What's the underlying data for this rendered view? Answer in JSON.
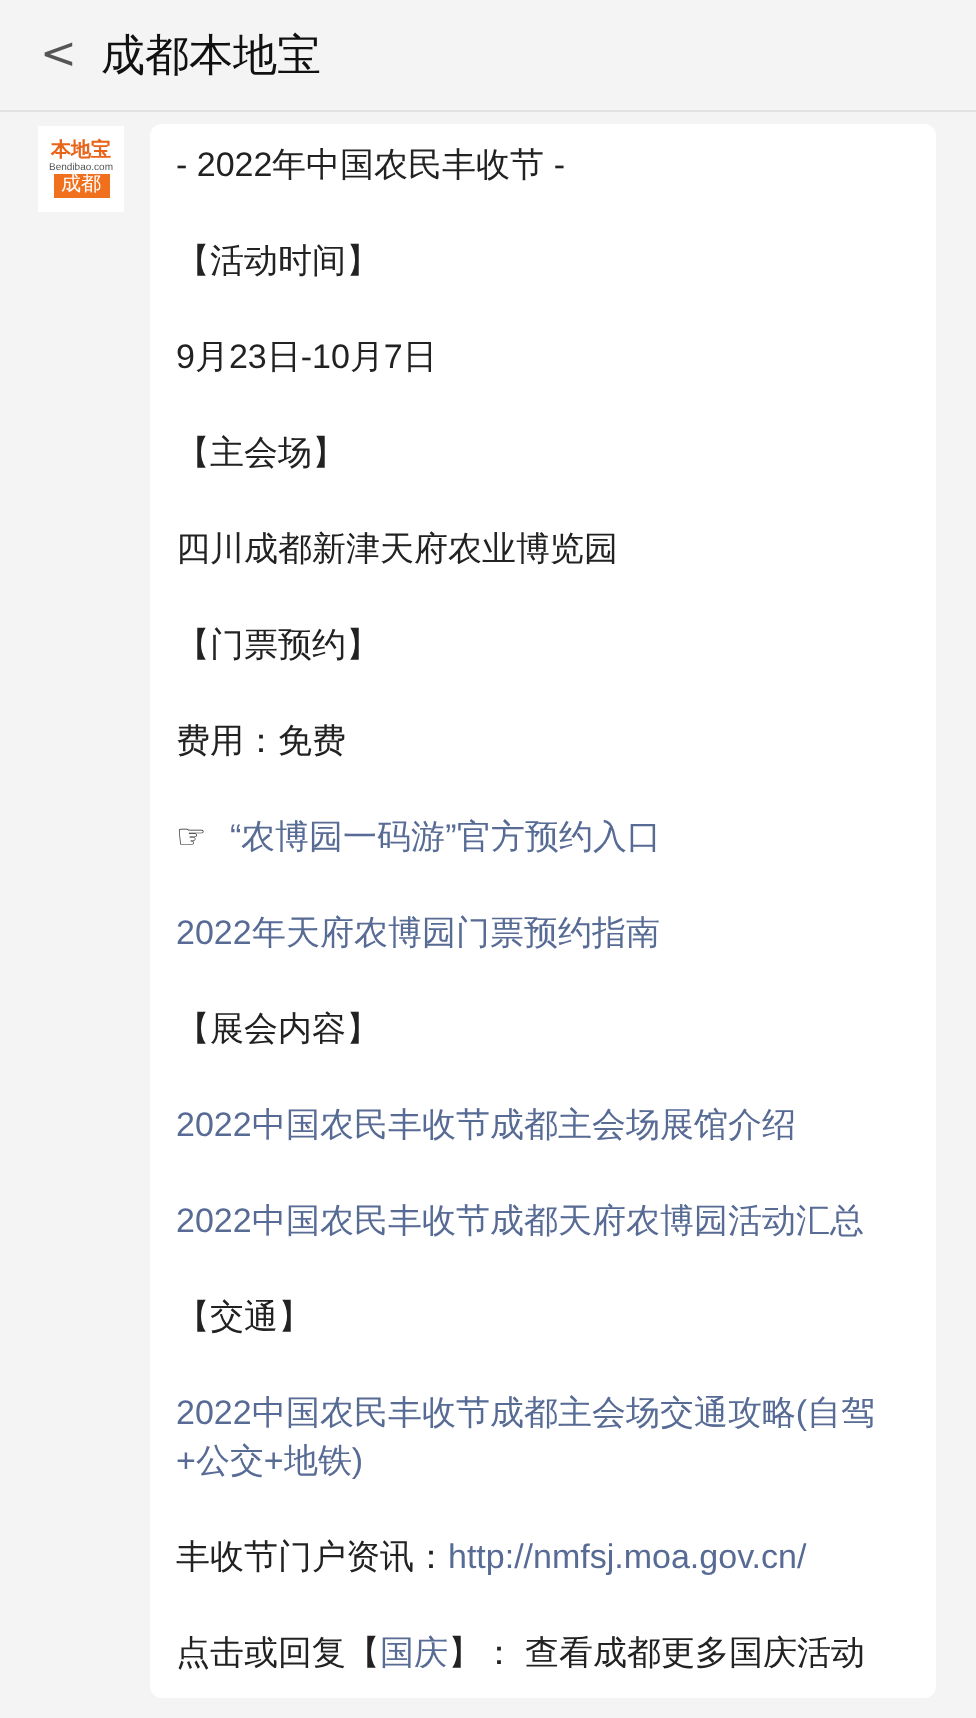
{
  "header": {
    "back": "<",
    "title": "成都本地宝"
  },
  "avatar": {
    "top": "本地宝",
    "sub": "Bendibao.com",
    "bottom": "成都"
  },
  "paragraphs": [
    {
      "segments": [
        {
          "text": "- 2022年中国农民丰收节 -",
          "link": false
        }
      ]
    },
    {
      "segments": [
        {
          "text": "【活动时间】",
          "link": false
        }
      ]
    },
    {
      "segments": [
        {
          "text": "9月23日-10月7日",
          "link": false
        }
      ]
    },
    {
      "segments": [
        {
          "text": "【主会场】",
          "link": false
        }
      ]
    },
    {
      "segments": [
        {
          "text": "四川成都新津天府农业博览园",
          "link": false
        }
      ]
    },
    {
      "segments": [
        {
          "text": "【门票预约】",
          "link": false
        }
      ]
    },
    {
      "segments": [
        {
          "text": "费用：免费",
          "link": false
        }
      ]
    },
    {
      "segments": [
        {
          "text": "☞",
          "link": false
        },
        {
          "text": "“农博园一码游”官方预约入口",
          "link": true
        }
      ]
    },
    {
      "segments": [
        {
          "text": "2022年天府农博园门票预约指南",
          "link": true
        }
      ]
    },
    {
      "segments": [
        {
          "text": "【展会内容】",
          "link": false
        }
      ]
    },
    {
      "segments": [
        {
          "text": "2022中国农民丰收节成都主会场展馆介绍",
          "link": true
        }
      ]
    },
    {
      "segments": [
        {
          "text": "2022中国农民丰收节成都天府农博园活动汇总",
          "link": true
        }
      ]
    },
    {
      "segments": [
        {
          "text": "【交通】",
          "link": false
        }
      ]
    },
    {
      "segments": [
        {
          "text": "2022中国农民丰收节成都主会场交通攻略(自驾+公交+地铁)",
          "link": true
        }
      ]
    },
    {
      "segments": [
        {
          "text": "丰收节门户资讯：",
          "link": false
        },
        {
          "text": "http://nmfsj.moa.gov.cn/",
          "link": true
        }
      ]
    },
    {
      "segments": [
        {
          "text": "点击或回复【",
          "link": false
        },
        {
          "text": "国庆",
          "link": true
        },
        {
          "text": "】： 查看成都更多国庆活动",
          "link": false
        }
      ]
    }
  ]
}
